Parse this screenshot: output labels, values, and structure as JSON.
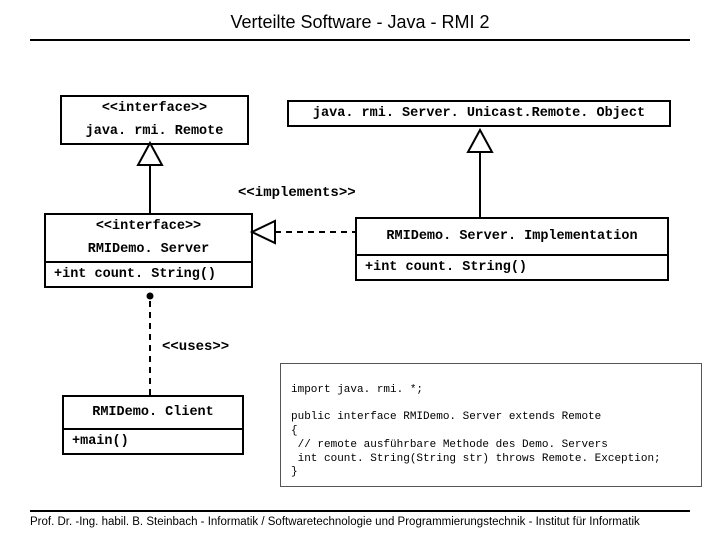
{
  "title": "Verteilte Software - Java - RMI 2",
  "footer": "Prof. Dr. -Ing. habil. B. Steinbach - Informatik / Softwaretechnologie und Programmierungstechnik - Institut für Informatik",
  "boxes": {
    "remote": {
      "stereo": "<<interface>>",
      "name": "java. rmi. Remote"
    },
    "unicast": {
      "name": "java. rmi. Server. Unicast.Remote. Object"
    },
    "demoServer": {
      "stereo": "<<interface>>",
      "name": "RMIDemo. Server",
      "op": "+int count. String()"
    },
    "impl": {
      "name": "RMIDemo. Server. Implementation",
      "op": "+int count. String()"
    },
    "client": {
      "name": "RMIDemo. Client",
      "op": "+main()"
    }
  },
  "labels": {
    "implements": "<<implements>>",
    "uses": "<<uses>>"
  },
  "code": {
    "l1": "import java. rmi. *;",
    "l2": "public interface RMIDemo. Server extends Remote",
    "l3": "{",
    "l4": " // remote ausführbare Methode des Demo. Servers",
    "l5": " int count. String(String str) throws Remote. Exception;",
    "l6": "}"
  }
}
